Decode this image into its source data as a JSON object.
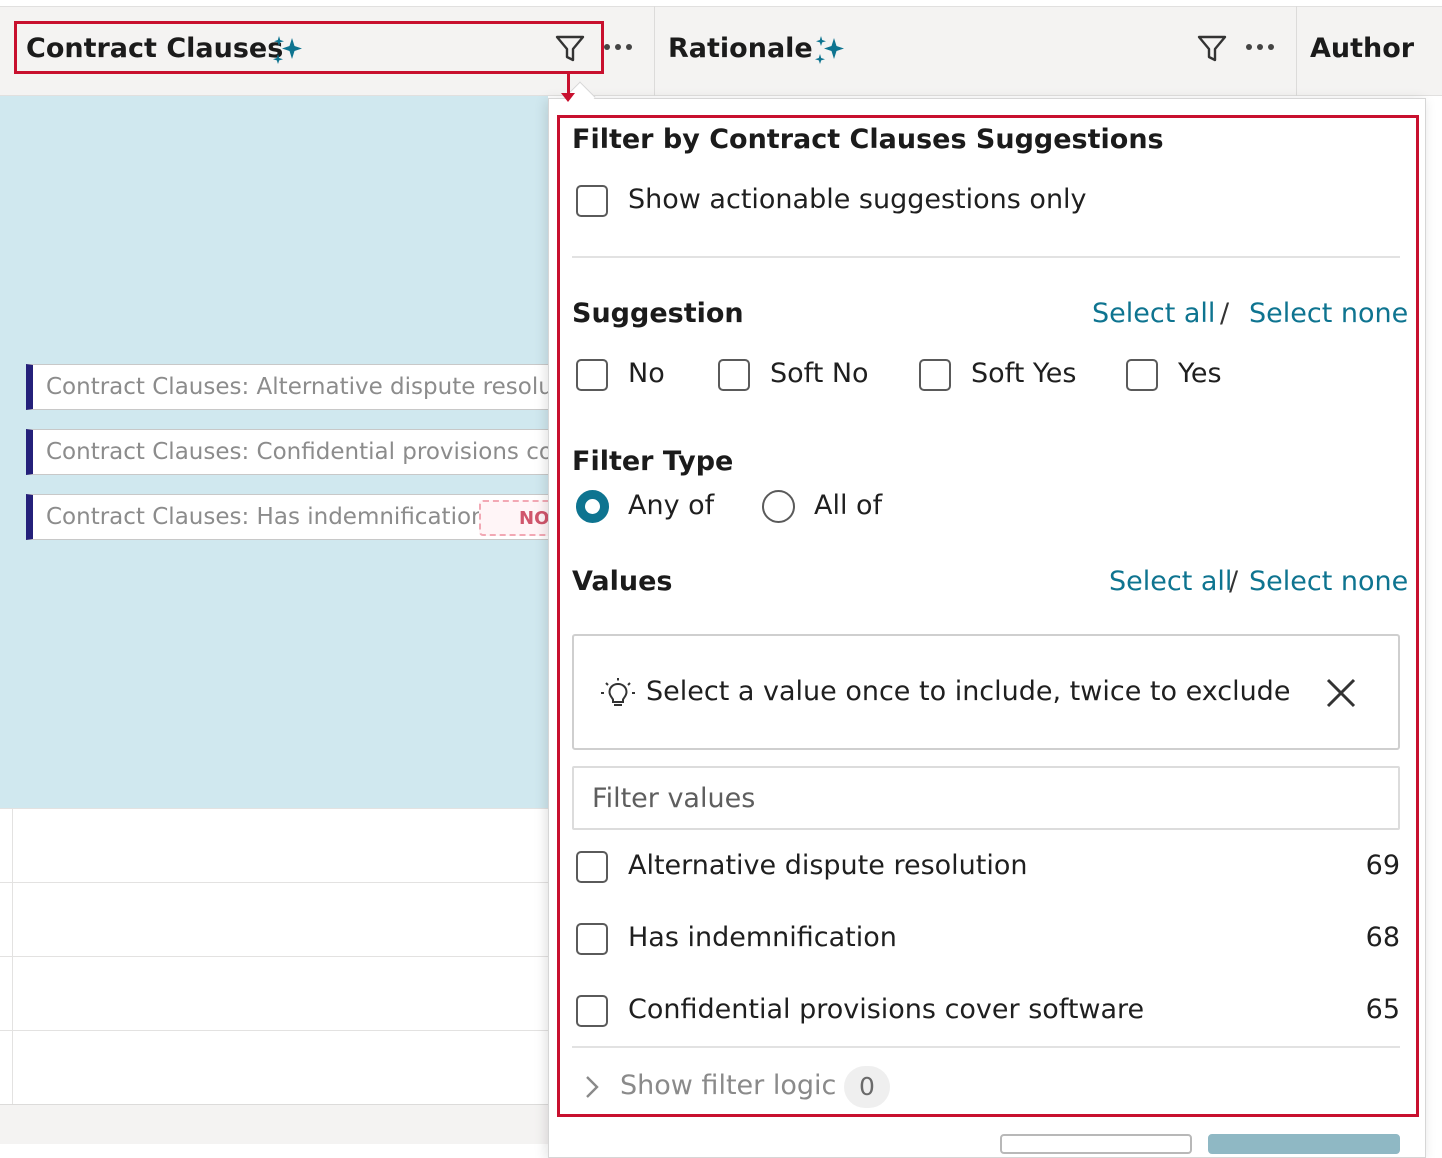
{
  "table": {
    "columns": [
      {
        "title": "Contract Clauses"
      },
      {
        "title": "Rationale"
      },
      {
        "title": "Author"
      }
    ],
    "chips": [
      {
        "label": "Contract Clauses: Alternative dispute resoluti"
      },
      {
        "label": "Contract Clauses: Confidential provisions cov"
      },
      {
        "label": "Contract Clauses: Has indemnification",
        "badge": "NO"
      }
    ]
  },
  "filter_popover": {
    "title": "Filter by Contract Clauses Suggestions",
    "actionable_only_label": "Show actionable suggestions only",
    "suggestion": {
      "heading": "Suggestion",
      "select_all": "Select all",
      "separator": "/",
      "select_none": "Select none",
      "options": [
        "No",
        "Soft No",
        "Soft Yes",
        "Yes"
      ]
    },
    "filter_type": {
      "heading": "Filter Type",
      "options": [
        "Any of",
        "All of"
      ],
      "selected": "Any of"
    },
    "values": {
      "heading": "Values",
      "select_all": "Select all",
      "separator": "/",
      "select_none": "Select none",
      "hint": "Select a value once to include, twice to exclude",
      "search_placeholder": "Filter values",
      "items": [
        {
          "label": "Alternative dispute resolution",
          "count": "69"
        },
        {
          "label": "Has indemnification",
          "count": "68"
        },
        {
          "label": "Confidential provisions cover software",
          "count": "65"
        }
      ]
    },
    "filter_logic": {
      "label": "Show filter logic",
      "count": "0"
    }
  },
  "colors": {
    "accent": "#0e7490",
    "highlight": "#c8102e",
    "row_selected": "#d0e8ef",
    "chip_bar": "#24207a"
  },
  "icons": [
    "sparkle-icon",
    "filter-icon",
    "more-icon",
    "lightbulb-icon",
    "close-icon",
    "chevron-right-icon"
  ]
}
